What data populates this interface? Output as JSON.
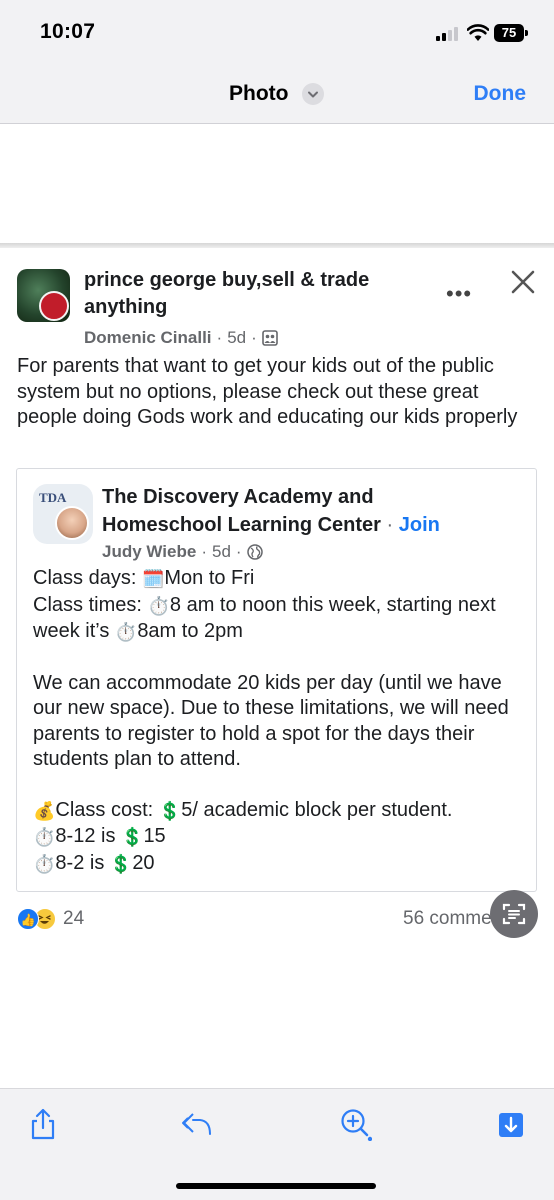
{
  "status_bar": {
    "time": "10:07",
    "battery": "75"
  },
  "nav": {
    "title": "Photo",
    "done_label": "Done"
  },
  "post": {
    "group_name": "prince george buy,sell & trade anything",
    "author": "Domenic Cinalli",
    "age": "5d",
    "text": "For parents that want to get your kids out of the public system but no options, please check out these great people doing Gods work and educating our kids properly",
    "shared": {
      "page_avatar_text": "TDA",
      "page_name": "The Discovery Academy and Homeschool Learning Center",
      "join_label": "Join",
      "author": "Judy Wiebe",
      "age": "5d",
      "line1_a": "Class days:",
      "line1_b": "Mon to Fri",
      "line2_a": "Class times:",
      "line2_b": "8 am to noon this week, starting next week it’s",
      "line2_c": "8am to 2pm",
      "para2": "We can accommodate 20 kids per day  (until we have our new space). Due to these limitations, we will need parents to register to hold a spot for the days their students plan to attend.",
      "cost_label": "Class cost:",
      "cost_value": "5/ academic block per student.",
      "price1_label": "8-12 is",
      "price1_value": "15",
      "price2_label": "8-2 is",
      "price2_value": "20"
    },
    "reactions_count": "24",
    "comments_label": "56 comments"
  },
  "icons": {
    "calendar": "🗓️",
    "stopwatch": "⏱️",
    "money_bag": "💰",
    "dollar": "💲",
    "like": "👍",
    "more": "•••"
  },
  "colors": {
    "link": "#1877f2",
    "ios_blue": "#2f7ef6",
    "secondary_text": "#65676b"
  }
}
